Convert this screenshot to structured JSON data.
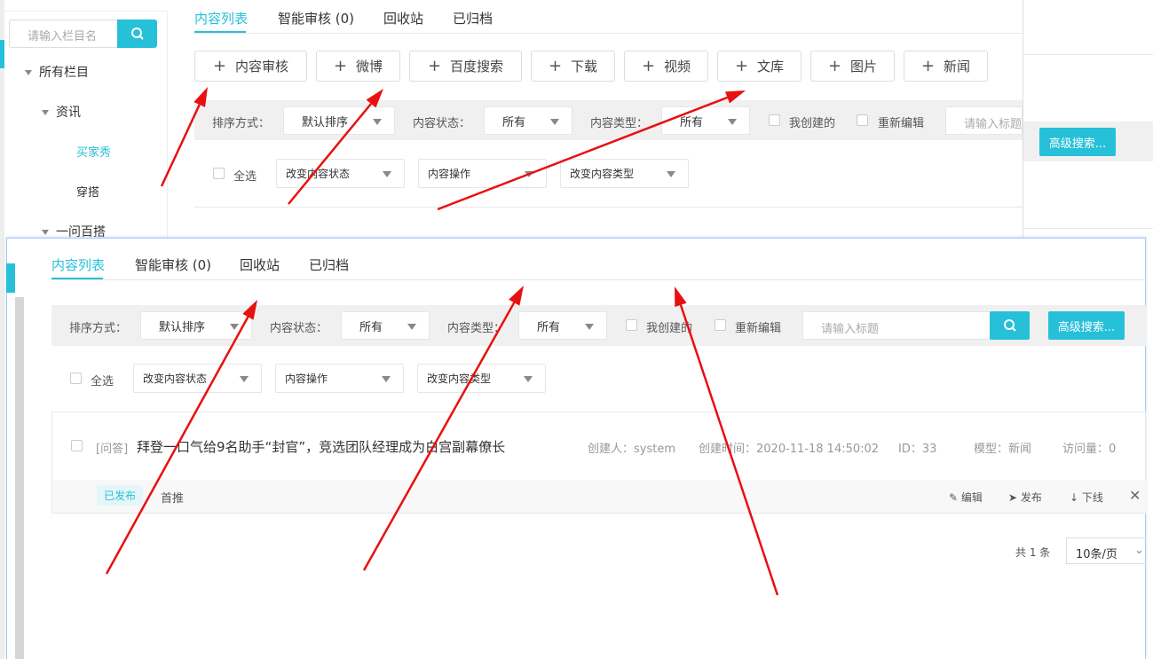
{
  "sidebar": {
    "search_placeholder": "请输入栏目名",
    "tree": [
      {
        "label": "所有栏目"
      },
      {
        "label": "资讯"
      },
      {
        "label": "买家秀"
      },
      {
        "label": "穿搭"
      },
      {
        "label": "一问百搭"
      }
    ]
  },
  "back": {
    "tabs": [
      "内容列表",
      "智能审核 (0)",
      "回收站",
      "已归档"
    ],
    "add_buttons": [
      "内容审核",
      "微博",
      "百度搜索",
      "下载",
      "视频",
      "文库",
      "图片",
      "新闻"
    ],
    "filters": {
      "sort_label": "排序方式：",
      "sort_value": "默认排序",
      "status_label": "内容状态：",
      "status_value": "所有",
      "type_label": "内容类型：",
      "type_value": "所有",
      "mine": "我创建的",
      "reedit": "重新编辑",
      "title_placeholder": "请输入标题",
      "advanced": "高级搜索..."
    },
    "bulk": {
      "select_all": "全选",
      "change_status": "改变内容状态",
      "operation": "内容操作",
      "change_type": "改变内容类型"
    }
  },
  "front": {
    "tabs": [
      "内容列表",
      "智能审核 (0)",
      "回收站",
      "已归档"
    ],
    "filters": {
      "sort_label": "排序方式：",
      "sort_value": "默认排序",
      "status_label": "内容状态：",
      "status_value": "所有",
      "type_label": "内容类型：",
      "type_value": "所有",
      "mine": "我创建的",
      "reedit": "重新编辑",
      "title_placeholder": "请输入标题",
      "advanced": "高级搜索..."
    },
    "bulk": {
      "select_all": "全选",
      "change_status": "改变内容状态",
      "operation": "内容操作",
      "change_type": "改变内容类型"
    },
    "item": {
      "tag": "[问答]",
      "title": "拜登一口气给9名助手“封官”，竞选团队经理成为白宫副幕僚长",
      "creator": "创建人：system",
      "created": "创建时间：2020-11-18 14:50:02",
      "id": "ID：33",
      "model": "模型：新闻",
      "views": "访问量：0",
      "status": "已发布",
      "channel": "首推",
      "actions": {
        "edit": "编辑",
        "publish": "发布",
        "offline": "下线"
      }
    },
    "pagination": {
      "total": "共 1 条",
      "page_size": "10条/页"
    }
  },
  "colors": {
    "accent": "#26c0d9",
    "arrow": "#e81010"
  }
}
